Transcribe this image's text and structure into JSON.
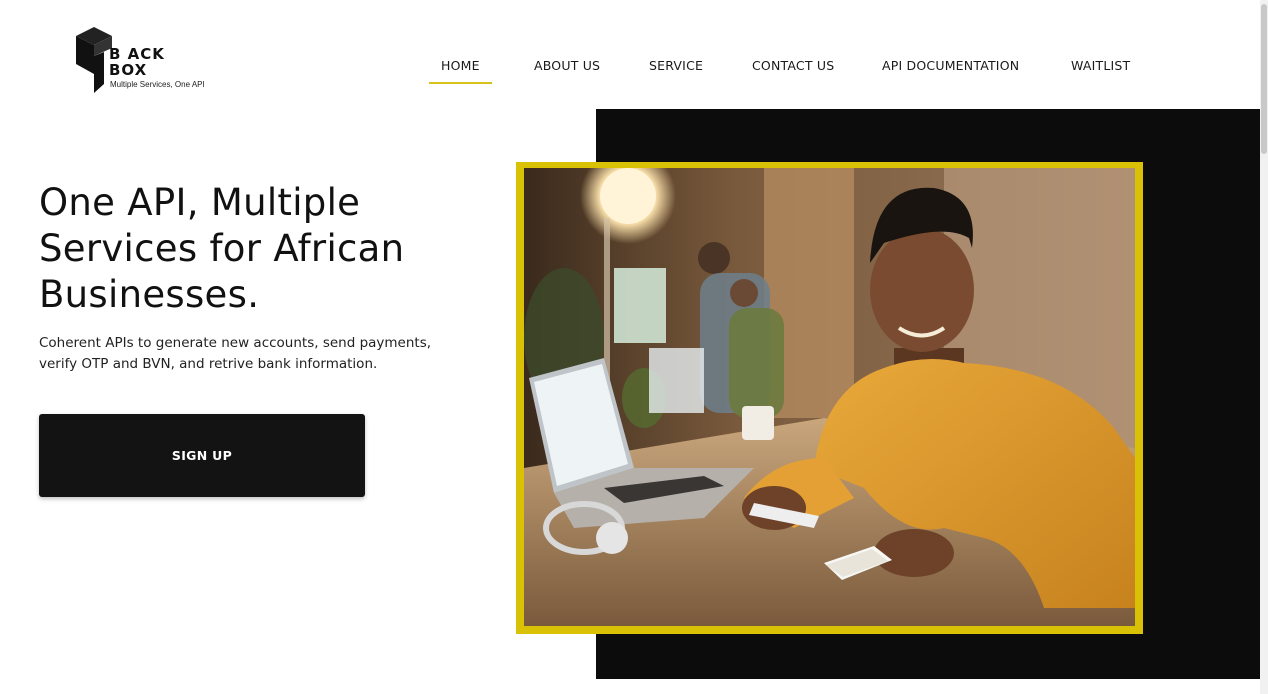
{
  "logo": {
    "word1": "B ACK",
    "word2": "BOX",
    "tagline": "Multiple Services, One API",
    "icon": "cube-logo-icon"
  },
  "nav": {
    "items": [
      {
        "label": "HOME",
        "active": true
      },
      {
        "label": "ABOUT US",
        "active": false
      },
      {
        "label": "SERVICE",
        "active": false
      },
      {
        "label": "CONTACT US",
        "active": false
      },
      {
        "label": "API DOCUMENTATION",
        "active": false
      },
      {
        "label": "WAITLIST",
        "active": false
      }
    ],
    "active_underline_color": "#d7c21a"
  },
  "hero": {
    "title_line1": "One API, Multiple",
    "title_line2": "Services for African",
    "title_line3": "Businesses.",
    "subtitle_line1": "Coherent APIs to generate new accounts, send payments,",
    "subtitle_line2": "verify OTP and BVN, and retrive bank information.",
    "cta_label": "SIGN UP"
  },
  "colors": {
    "accent_yellow": "#d9c205",
    "panel_black": "#0c0c0c",
    "button_black": "#131313"
  },
  "photo": {
    "icon": "hero-photo-image"
  }
}
